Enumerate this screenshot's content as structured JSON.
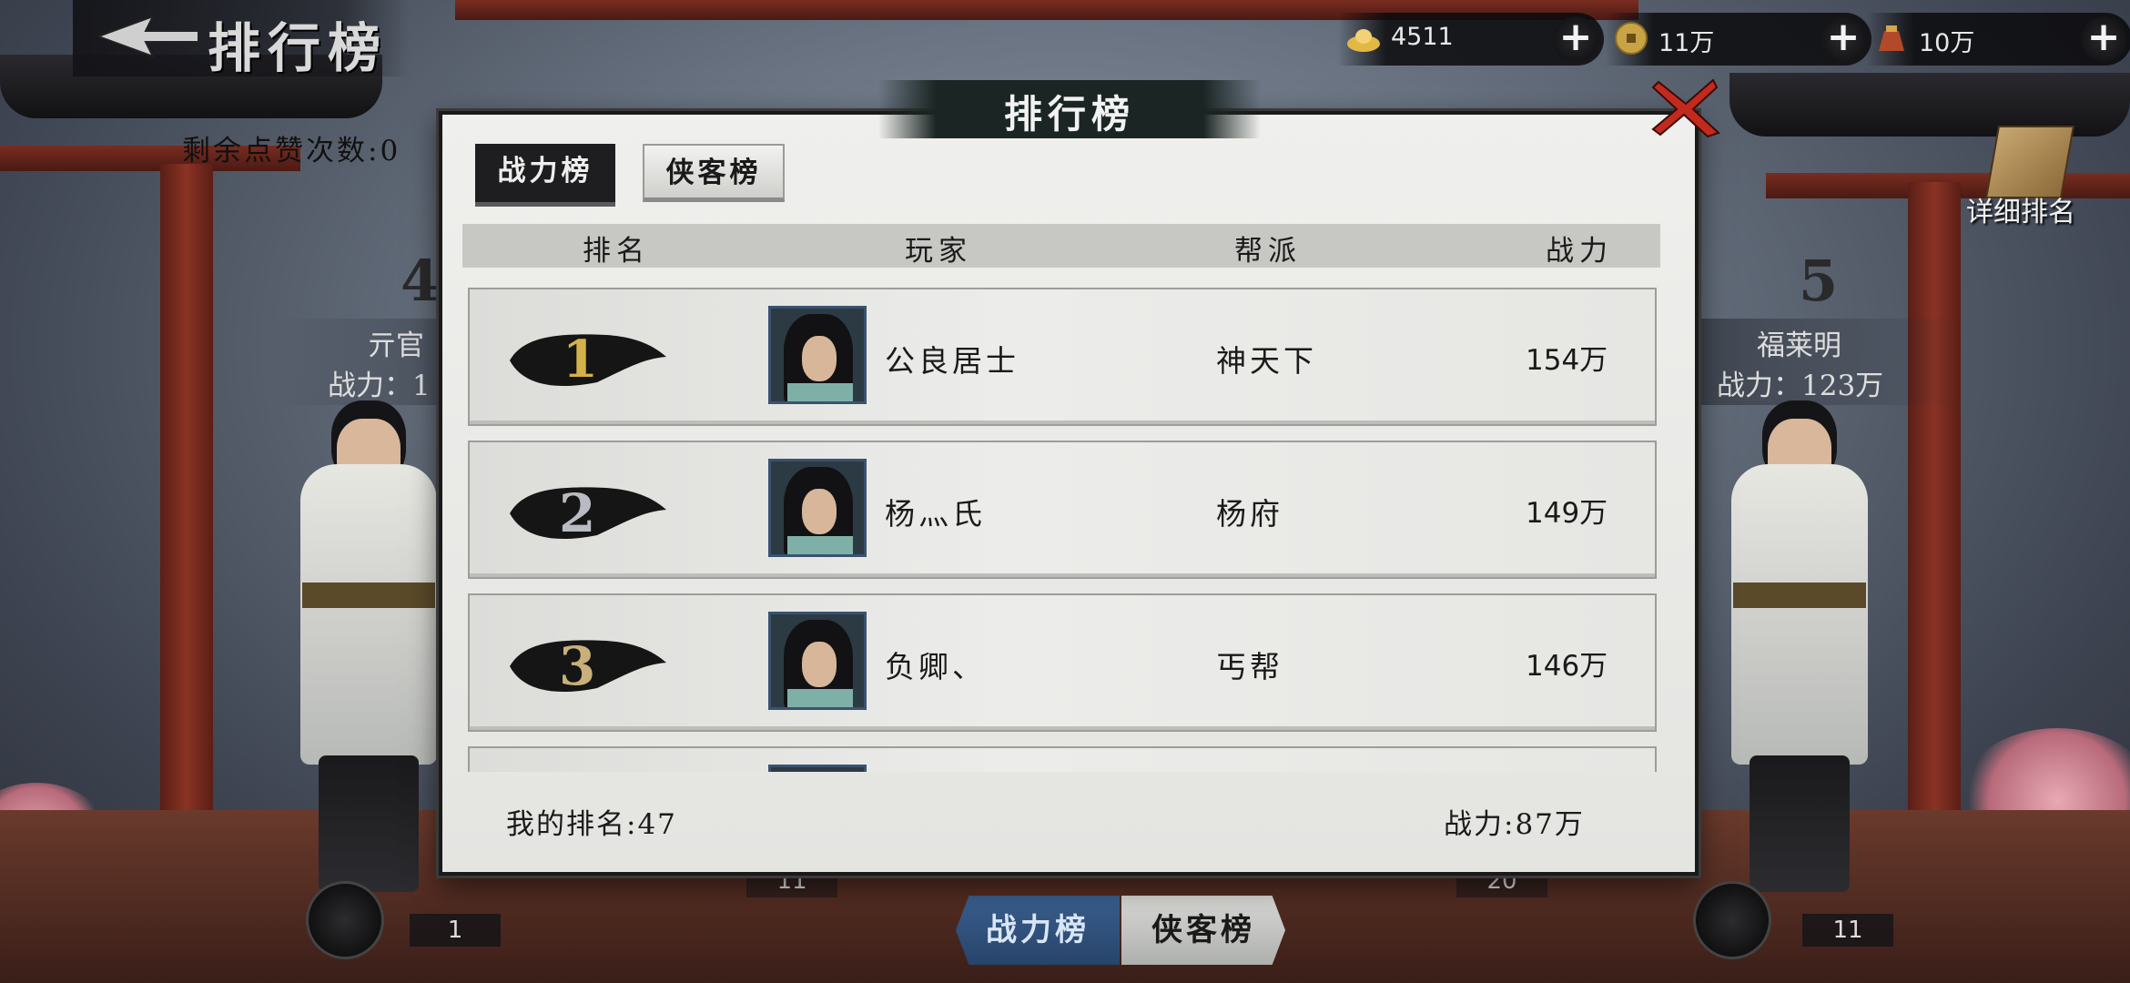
{
  "header": {
    "title": "排行榜",
    "likes_left": "剩余点赞次数:0"
  },
  "currencies": [
    {
      "icon": "gold-ingot-icon",
      "value": "4511"
    },
    {
      "icon": "coin-icon",
      "value": "11万"
    },
    {
      "icon": "money-bag-icon",
      "value": "10万"
    }
  ],
  "detail_rank_label": "详细排名",
  "side_left": {
    "rank": "4",
    "name": "亓官",
    "power": "战力：1",
    "pedestal": "1"
  },
  "side_right": {
    "rank": "5",
    "name": "福莱明",
    "power": "战力：123万",
    "pedestal": "11"
  },
  "center_pedestals": [
    "11",
    "20"
  ],
  "bottom_tabs": {
    "active": "战力榜",
    "inactive": "侠客榜"
  },
  "modal": {
    "title": "排行榜",
    "tabs": {
      "active": "战力榜",
      "inactive": "侠客榜"
    },
    "columns": [
      "排名",
      "玩家",
      "帮派",
      "战力"
    ],
    "rows": [
      {
        "rank": "1",
        "player": "公良居士",
        "guild": "神天下",
        "power": "154万"
      },
      {
        "rank": "2",
        "player": "杨灬氏",
        "guild": "杨府",
        "power": "149万"
      },
      {
        "rank": "3",
        "player": "负卿、",
        "guild": "丐帮",
        "power": "146万"
      }
    ],
    "my_rank": "我的排名:47",
    "my_power": "战力:87万"
  },
  "colors": {
    "accent_blue": "#2f5480",
    "brush_gold": "#d4b24a",
    "close_red": "#c22a1e"
  }
}
